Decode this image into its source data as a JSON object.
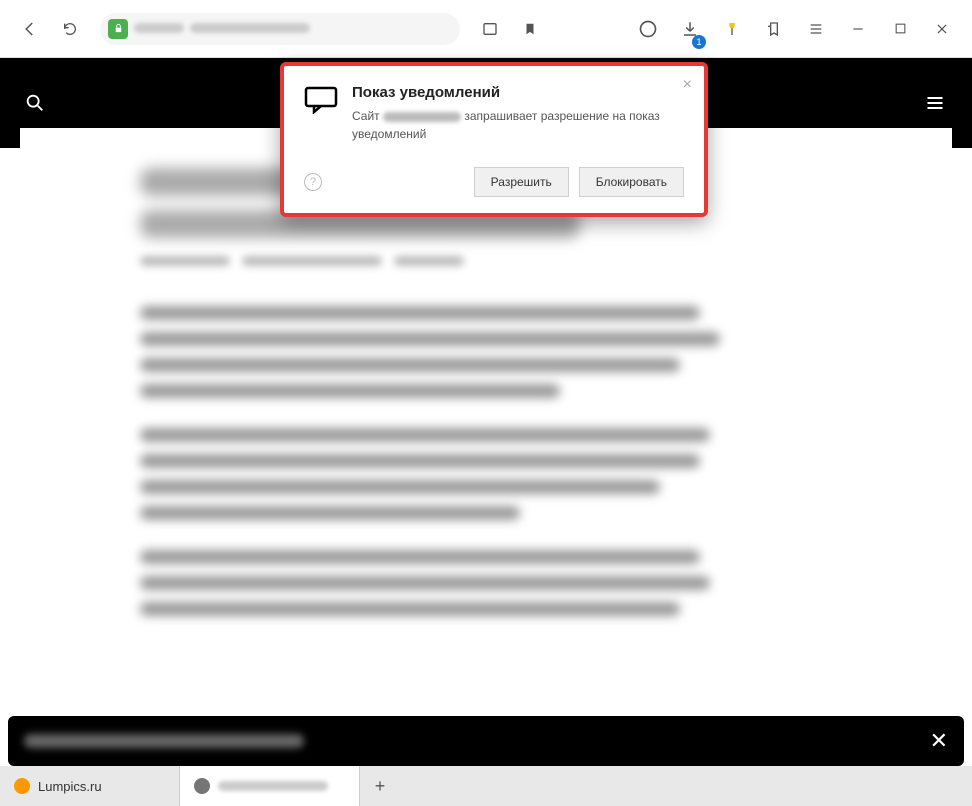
{
  "toolbar": {
    "download_badge": "1"
  },
  "dialog": {
    "title": "Показ уведомлений",
    "text_prefix": "Сайт",
    "text_suffix": "запрашивает разрешение на показ уведомлений",
    "allow_label": "Разрешить",
    "block_label": "Блокировать"
  },
  "tabs": [
    {
      "label": "Lumpics.ru",
      "favicon": "#ff9800"
    },
    {
      "label": "",
      "favicon": "#757575"
    }
  ],
  "colors": {
    "highlight_border": "#e53935",
    "lock_green": "#4caf50"
  }
}
